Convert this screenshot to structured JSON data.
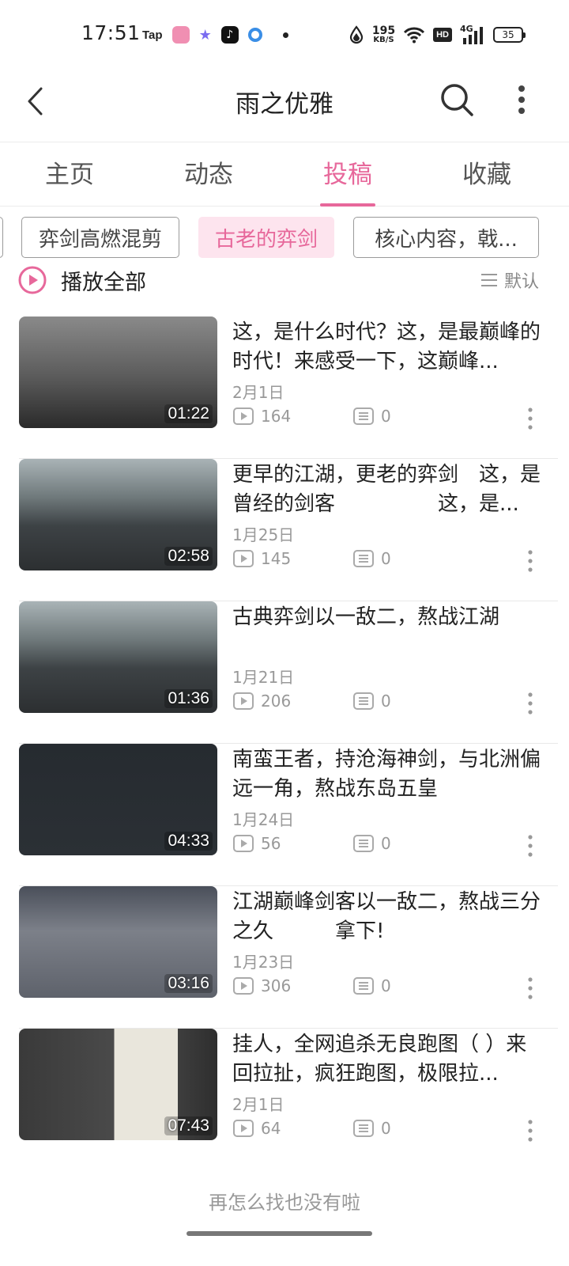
{
  "status_bar": {
    "time": "17:51",
    "app_label": "Tap",
    "net_speed_value": "195",
    "net_speed_unit": "KB/S",
    "hd_label": "HD",
    "network_label": "4G",
    "battery": "35"
  },
  "header": {
    "title": "雨之优雅"
  },
  "tabs": [
    {
      "label": "主页"
    },
    {
      "label": "动态"
    },
    {
      "label": "投稿"
    },
    {
      "label": "收藏"
    }
  ],
  "active_tab": "投稿",
  "chips": [
    {
      "label": "弈剑高燃混剪"
    },
    {
      "label": "古老的弈剑"
    },
    {
      "label": "核心内容，戟..."
    }
  ],
  "play_all": {
    "label": "播放全部",
    "sort_label": "默认"
  },
  "videos": [
    {
      "title": "这，是什么时代？这，是最巅峰的时代！来感受一下，这巅峰...",
      "date": "2月1日",
      "views": "164",
      "comments": "0",
      "duration": "01:22"
    },
    {
      "title": "更早的江湖，更老的弈剑　这，是曾经的剑客　　　　　这，是...",
      "date": "1月25日",
      "views": "145",
      "comments": "0",
      "duration": "02:58"
    },
    {
      "title": "古典弈剑以一敌二，熬战江湖",
      "date": "1月21日",
      "views": "206",
      "comments": "0",
      "duration": "01:36"
    },
    {
      "title": "南蛮王者，持沧海神剑，与北洲偏远一角，熬战东岛五皇",
      "date": "1月24日",
      "views": "56",
      "comments": "0",
      "duration": "04:33"
    },
    {
      "title": "江湖巅峰剑客以一敌二，熬战三分之久　　　拿下!",
      "date": "1月23日",
      "views": "306",
      "comments": "0",
      "duration": "03:16"
    },
    {
      "title": "挂人，全网追杀无良跑图（ ）来回拉扯，疯狂跑图，极限拉...",
      "date": "2月1日",
      "views": "64",
      "comments": "0",
      "duration": "07:43"
    }
  ],
  "footer_text": "再怎么找也没有啦",
  "colors": {
    "accent": "#e7689b",
    "chip_active_bg": "#fde4ee",
    "muted": "#999999"
  }
}
